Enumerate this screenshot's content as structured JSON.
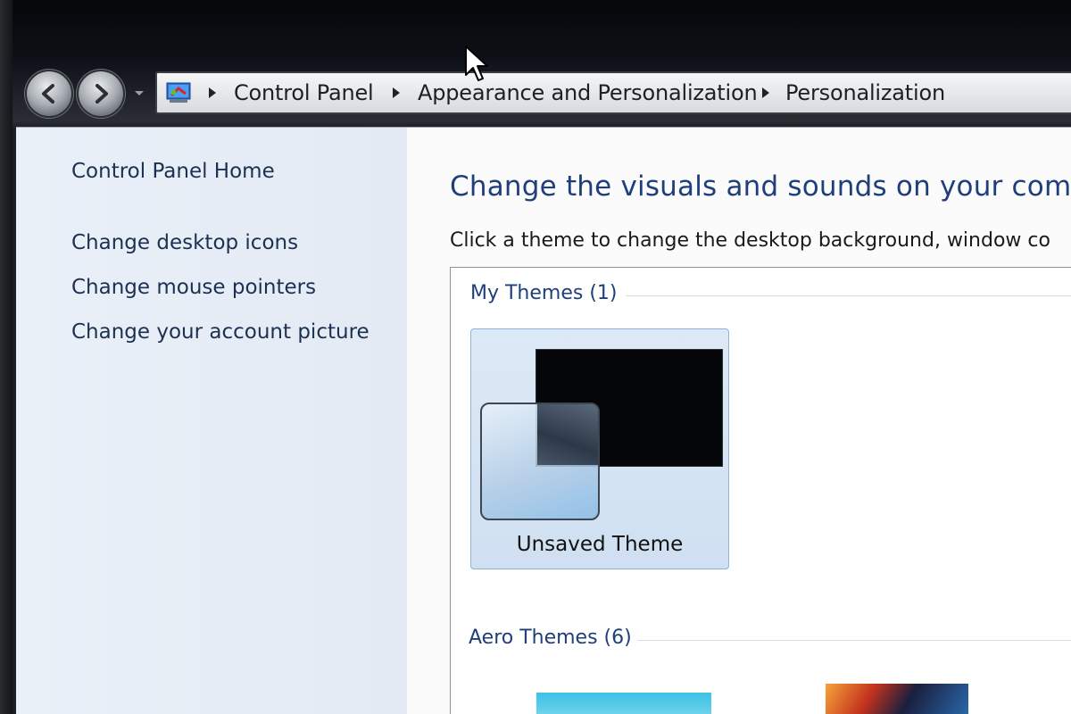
{
  "breadcrumb": {
    "items": [
      "Control Panel",
      "Appearance and Personalization",
      "Personalization"
    ]
  },
  "sidebar": {
    "home_label": "Control Panel Home",
    "links": [
      "Change desktop icons",
      "Change mouse pointers",
      "Change your account picture"
    ]
  },
  "main": {
    "title": "Change the visuals and sounds on your compu",
    "subtitle": "Click a theme to change the desktop background, window co"
  },
  "themes": {
    "groups": [
      {
        "header": "My Themes (1)",
        "items": [
          {
            "label": "Unsaved Theme"
          }
        ]
      },
      {
        "header": "Aero Themes (6)"
      }
    ]
  },
  "icons": {
    "back": "back-arrow-icon",
    "forward": "forward-arrow-icon",
    "dropdown": "chevron-down-icon",
    "control_panel": "control-panel-icon",
    "cursor": "mouse-cursor-icon"
  },
  "colors": {
    "link": "#1c3152",
    "heading": "#1e3f7a",
    "sidebar_bg": "#e3eaf4",
    "selected_tile": "#cfe0f2"
  }
}
